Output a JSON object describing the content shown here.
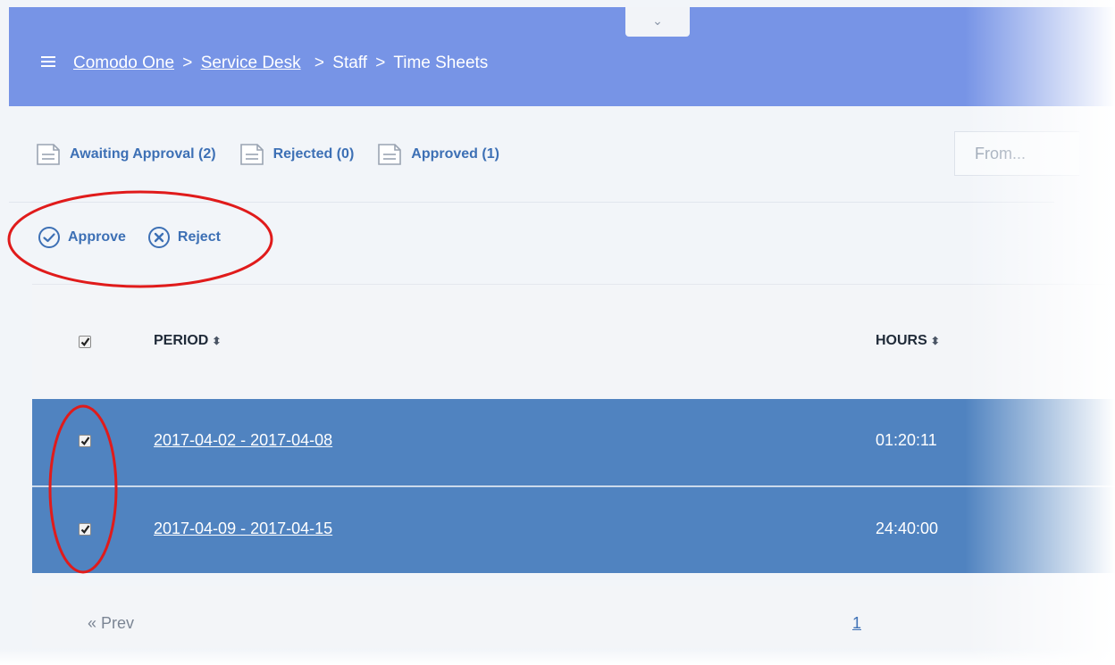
{
  "header": {
    "collapse_glyph": "⌄",
    "breadcrumb": {
      "link1": "Comodo One",
      "link2": "Service Desk",
      "sep": ">",
      "item3": "Staff",
      "item4": "Time Sheets"
    }
  },
  "status_tabs": [
    {
      "label": "Awaiting Approval (2)",
      "icon": "document-icon"
    },
    {
      "label": "Rejected (0)",
      "icon": "document-icon"
    },
    {
      "label": "Approved (1)",
      "icon": "document-icon"
    }
  ],
  "filter": {
    "from_placeholder": "From..."
  },
  "actions": {
    "approve_label": "Approve",
    "approve_icon": "check-circle-icon",
    "reject_label": "Reject",
    "reject_icon": "x-circle-icon"
  },
  "table": {
    "columns": [
      {
        "label": "PERIOD",
        "sort_glyph": "⬍"
      },
      {
        "label": "HOURS",
        "sort_glyph": "⬍"
      }
    ],
    "select_all_checked": true,
    "rows": [
      {
        "period": "2017-04-02 - 2017-04-08",
        "hours": "01:20:11",
        "selected": true
      },
      {
        "period": "2017-04-09 - 2017-04-15",
        "hours": "24:40:00",
        "selected": true
      }
    ]
  },
  "pagination": {
    "prev_label": "« Prev",
    "current_page": "1"
  },
  "colors": {
    "header_bg": "#7794e6",
    "selected_row": "#5083c0",
    "link": "#3d70b5",
    "annotation": "#e01b1b"
  }
}
